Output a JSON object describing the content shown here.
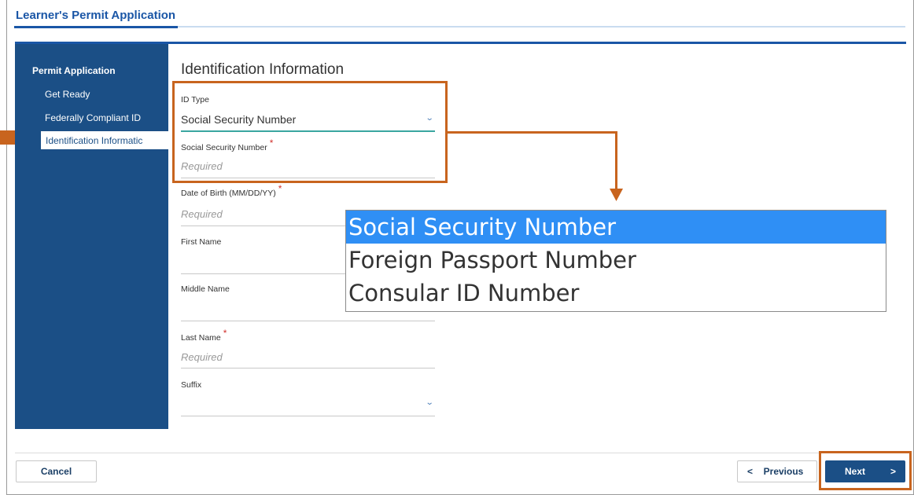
{
  "app": {
    "title": "Learner's Permit Application"
  },
  "sidebar": {
    "heading": "Permit Application",
    "items": [
      {
        "label": "Get Ready"
      },
      {
        "label": "Federally Compliant ID"
      },
      {
        "label": "Identification Informatic"
      }
    ]
  },
  "form": {
    "section_title": "Identification Information",
    "id_type": {
      "label": "ID Type",
      "value": "Social Security Number"
    },
    "ssn": {
      "label": "Social Security Number",
      "placeholder": "Required"
    },
    "dob": {
      "label": "Date of Birth (MM/DD/YY)",
      "placeholder": "Required"
    },
    "first_name": {
      "label": "First Name",
      "value": ""
    },
    "middle_name": {
      "label": "Middle Name",
      "value": ""
    },
    "last_name": {
      "label": "Last Name",
      "placeholder": "Required"
    },
    "suffix": {
      "label": "Suffix",
      "value": ""
    },
    "required_mark": "*"
  },
  "dropdown": {
    "options": [
      {
        "label": "Social Security Number",
        "selected": true
      },
      {
        "label": "Foreign Passport Number",
        "selected": false
      },
      {
        "label": "Consular ID Number",
        "selected": false
      }
    ]
  },
  "footer": {
    "cancel_label": "Cancel",
    "previous_label": "Previous",
    "next_label": "Next"
  },
  "icons": {
    "chevron_down": "chevron-down-icon",
    "chevron_left": "chevron-left-icon",
    "chevron_right": "chevron-right-icon"
  },
  "colors": {
    "brand_blue": "#1b4f86",
    "title_blue": "#1a56a6",
    "callout_orange": "#c8641e",
    "selected_option": "#2f8ff5",
    "required_red": "#d0312d"
  }
}
